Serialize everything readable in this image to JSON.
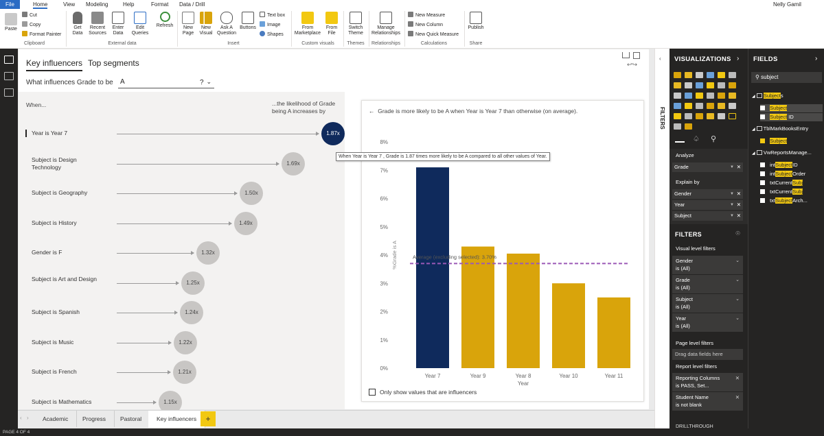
{
  "menu": {
    "tabs": [
      "File",
      "Home",
      "View",
      "Modeling",
      "Help",
      "Format",
      "Data / Drill"
    ],
    "user": "Nelly Gamil"
  },
  "ribbon": {
    "clipboard": {
      "paste": "Paste",
      "cut": "Cut",
      "copy": "Copy",
      "format_painter": "Format Painter",
      "label": "Clipboard"
    },
    "external": {
      "get_data": "Get Data",
      "recent_sources": "Recent Sources",
      "enter_data": "Enter Data",
      "edit_queries": "Edit Queries",
      "refresh": "Refresh",
      "label": "External data"
    },
    "insert": {
      "new_page": "New Page",
      "new_visual": "New Visual",
      "ask_question": "Ask A Question",
      "buttons": "Buttons",
      "text_box": "Text box",
      "image": "Image",
      "shapes": "Shapes",
      "label": "Insert"
    },
    "custom": {
      "from_marketplace": "From Marketplace",
      "from_file": "From File",
      "label": "Custom visuals"
    },
    "themes": {
      "switch_theme": "Switch Theme",
      "label": "Themes"
    },
    "relationships": {
      "manage": "Manage Relationships",
      "label": "Relationships"
    },
    "calculations": {
      "new_measure": "New Measure",
      "new_column": "New Column",
      "new_quick_measure": "New Quick Measure",
      "label": "Calculations"
    },
    "share": {
      "publish": "Publish",
      "label": "Share"
    }
  },
  "visual": {
    "tabs": [
      "Key influencers",
      "Top segments"
    ],
    "question_prefix": "What influences Grade to be",
    "question_value": "A",
    "question_mark": "?",
    "when_header": "When...",
    "likelihood_header_1": "...the likelihood of Grade",
    "likelihood_header_2": "being A increases by",
    "influencers": [
      {
        "label": "Year is Year 7",
        "value": "1.87x",
        "selected": true
      },
      {
        "label": "Subject is Design Technology",
        "value": "1.69x"
      },
      {
        "label": "Subject is Geography",
        "value": "1.50x"
      },
      {
        "label": "Subject is History",
        "value": "1.49x"
      },
      {
        "label": "Gender is F",
        "value": "1.32x"
      },
      {
        "label": "Subject is Art and Design",
        "value": "1.25x"
      },
      {
        "label": "Subject is Spanish",
        "value": "1.24x"
      },
      {
        "label": "Subject is Music",
        "value": "1.22x"
      },
      {
        "label": "Subject is French",
        "value": "1.21x"
      },
      {
        "label": "Subject is Mathematics",
        "value": "1.15x"
      }
    ],
    "detail_title": "Grade is more likely to be A when Year is Year 7 than otherwise (on average).",
    "tooltip": "When Year is Year 7 , Grade is 1.87 times more likely to be A compared to all other values of Year.",
    "avg_label": "Average (excluding selected): 3.70%",
    "checkbox_label": "Only show values that are influencers"
  },
  "chart_data": {
    "type": "bar",
    "categories": [
      "Year 7",
      "Year 9",
      "Year 8",
      "Year 10",
      "Year 11"
    ],
    "values": [
      7.1,
      4.3,
      4.05,
      3.0,
      2.5
    ],
    "highlight_index": 0,
    "average_line": 3.7,
    "xlabel": "Year",
    "ylabel": "%Grade is A",
    "yticks": [
      "0%",
      "1%",
      "2%",
      "3%",
      "4%",
      "5%",
      "6%",
      "7%",
      "8%"
    ],
    "ylim": [
      0,
      8
    ],
    "colors": {
      "highlight": "#0f2a5c",
      "bar": "#d9a40b",
      "avg": "#9b59b6"
    }
  },
  "filters_strip_label": "FILTERS",
  "viz_pane": {
    "title": "VISUALIZATIONS",
    "analyze": "Analyze",
    "analyze_well": "Grade",
    "explain_by": "Explain by",
    "explain_wells": [
      "Gender",
      "Year",
      "Subject"
    ],
    "filters_title": "FILTERS",
    "visual_level": "Visual level filters",
    "visual_filters": [
      {
        "name": "Gender",
        "state": "is (All)"
      },
      {
        "name": "Grade",
        "state": "is (All)"
      },
      {
        "name": "Subject",
        "state": "is (All)"
      },
      {
        "name": "Year",
        "state": "is (All)"
      }
    ],
    "page_level": "Page level filters",
    "drag_here": "Drag data fields here",
    "report_level": "Report level filters",
    "report_filters": [
      {
        "name": "Reporting Columns",
        "state": "is PASS, Set..."
      },
      {
        "name": "Student Name",
        "state": "is not blank"
      }
    ],
    "drillthrough": "DRILLTHROUGH"
  },
  "fields_pane": {
    "title": "FIELDS",
    "search_value": "subject",
    "tables": [
      {
        "name_pre": "",
        "name_hl": "Subject",
        "name_post": "s",
        "fields": [
          {
            "pre": "",
            "hl": "Subject",
            "post": ""
          },
          {
            "pre": "",
            "hl": "Subject",
            "post": " ID"
          }
        ]
      },
      {
        "name_pre": "TblMarkBooksEntry",
        "name_hl": "",
        "name_post": "",
        "fields": [
          {
            "pre": "",
            "hl": "Subject",
            "post": ""
          }
        ]
      },
      {
        "name_pre": "VwReportsManage...",
        "name_hl": "",
        "name_post": "",
        "fields": [
          {
            "pre": "int",
            "hl": "Subject",
            "post": "ID"
          },
          {
            "pre": "int",
            "hl": "Subject",
            "post": "Order"
          },
          {
            "pre": "txtCurrent",
            "hl": "Subj",
            "post": ""
          },
          {
            "pre": "txtCurrent",
            "hl": "Subj",
            "post": ""
          },
          {
            "pre": "txt",
            "hl": "Subject",
            "post": "Arch..."
          }
        ]
      }
    ]
  },
  "page_tabs": [
    "Academic",
    "Progress",
    "Pastoral",
    "Key influencers"
  ],
  "add_page": "+",
  "status": "PAGE 4 OF 4"
}
